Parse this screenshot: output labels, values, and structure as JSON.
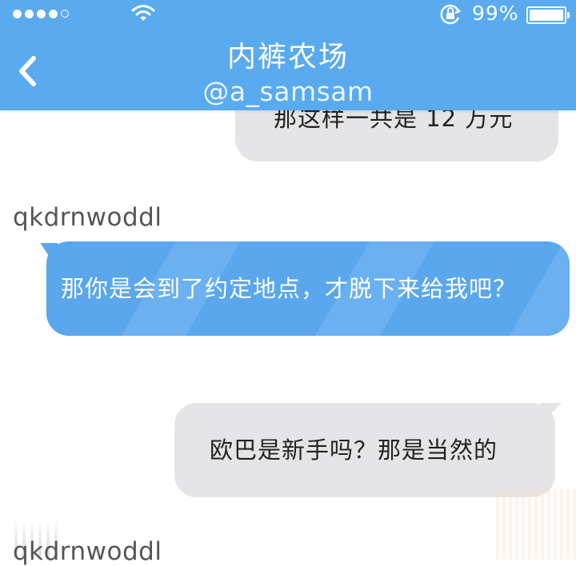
{
  "status_bar": {
    "signal_dots_filled": 4,
    "signal_dots_total": 5,
    "battery_percent": "99%",
    "icons": [
      "signal-dots-icon",
      "wifi-icon",
      "rotation-lock-icon",
      "battery-icon"
    ]
  },
  "header": {
    "title": "内裤农场",
    "subtitle": "@a_samsam",
    "back_icon": "chevron-left-icon",
    "color": "#5aaaf0"
  },
  "messages": [
    {
      "side": "right",
      "style": "gray",
      "text": "那这样一共是 12 万元"
    },
    {
      "sender": "qkdrnwoddl",
      "side": "left",
      "style": "blue",
      "text": "那你是会到了约定地点，才脱下来给我吧？"
    },
    {
      "side": "right",
      "style": "gray",
      "text": "欧巴是新手吗？那是当然的"
    },
    {
      "sender": "qkdrnwoddl"
    }
  ],
  "colors": {
    "blue_bubble": "#5aa7ee",
    "gray_bubble": "#e5e5e7"
  }
}
